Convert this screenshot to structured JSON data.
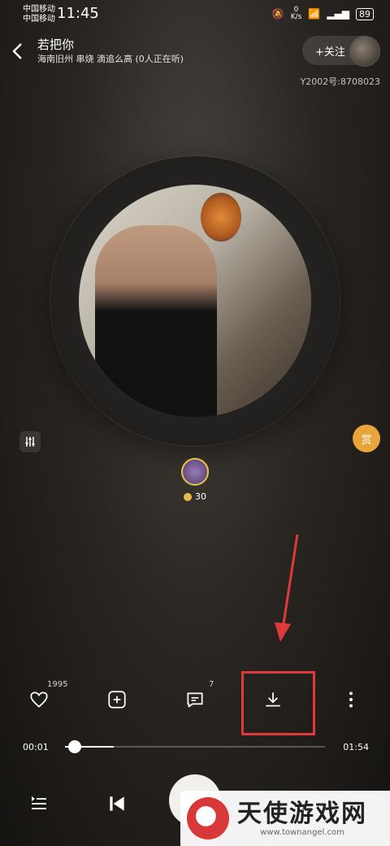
{
  "status_bar": {
    "carrier_1": "中国移动",
    "carrier_2": "中国移动",
    "time": "11:45",
    "network_speed": "0",
    "network_unit": "K/s",
    "battery": "89"
  },
  "header": {
    "title": "若把你",
    "meta": "海南旧州 串烧 滴追么高 (0人正在听)",
    "follow_label": "+关注",
    "user_id": "Y2002号:8708023"
  },
  "player": {
    "reward_label": "赏",
    "flower_count": "30",
    "like_count": "1995",
    "comment_count": "7",
    "current_time": "00:01",
    "total_time": "01:54",
    "progress": 0.01
  },
  "icons": {
    "back": "chevron-left-icon",
    "equalizer": "equalizer-icon",
    "like": "heart-icon",
    "add": "plus-square-icon",
    "comment": "comment-icon",
    "download": "download-icon",
    "more": "more-vertical-icon",
    "playlist": "playlist-icon",
    "previous": "skip-previous-icon"
  },
  "annotation": {
    "color": "#e0393b"
  },
  "watermark": {
    "brand": "天使游戏网",
    "url": "www.townangel.com"
  }
}
